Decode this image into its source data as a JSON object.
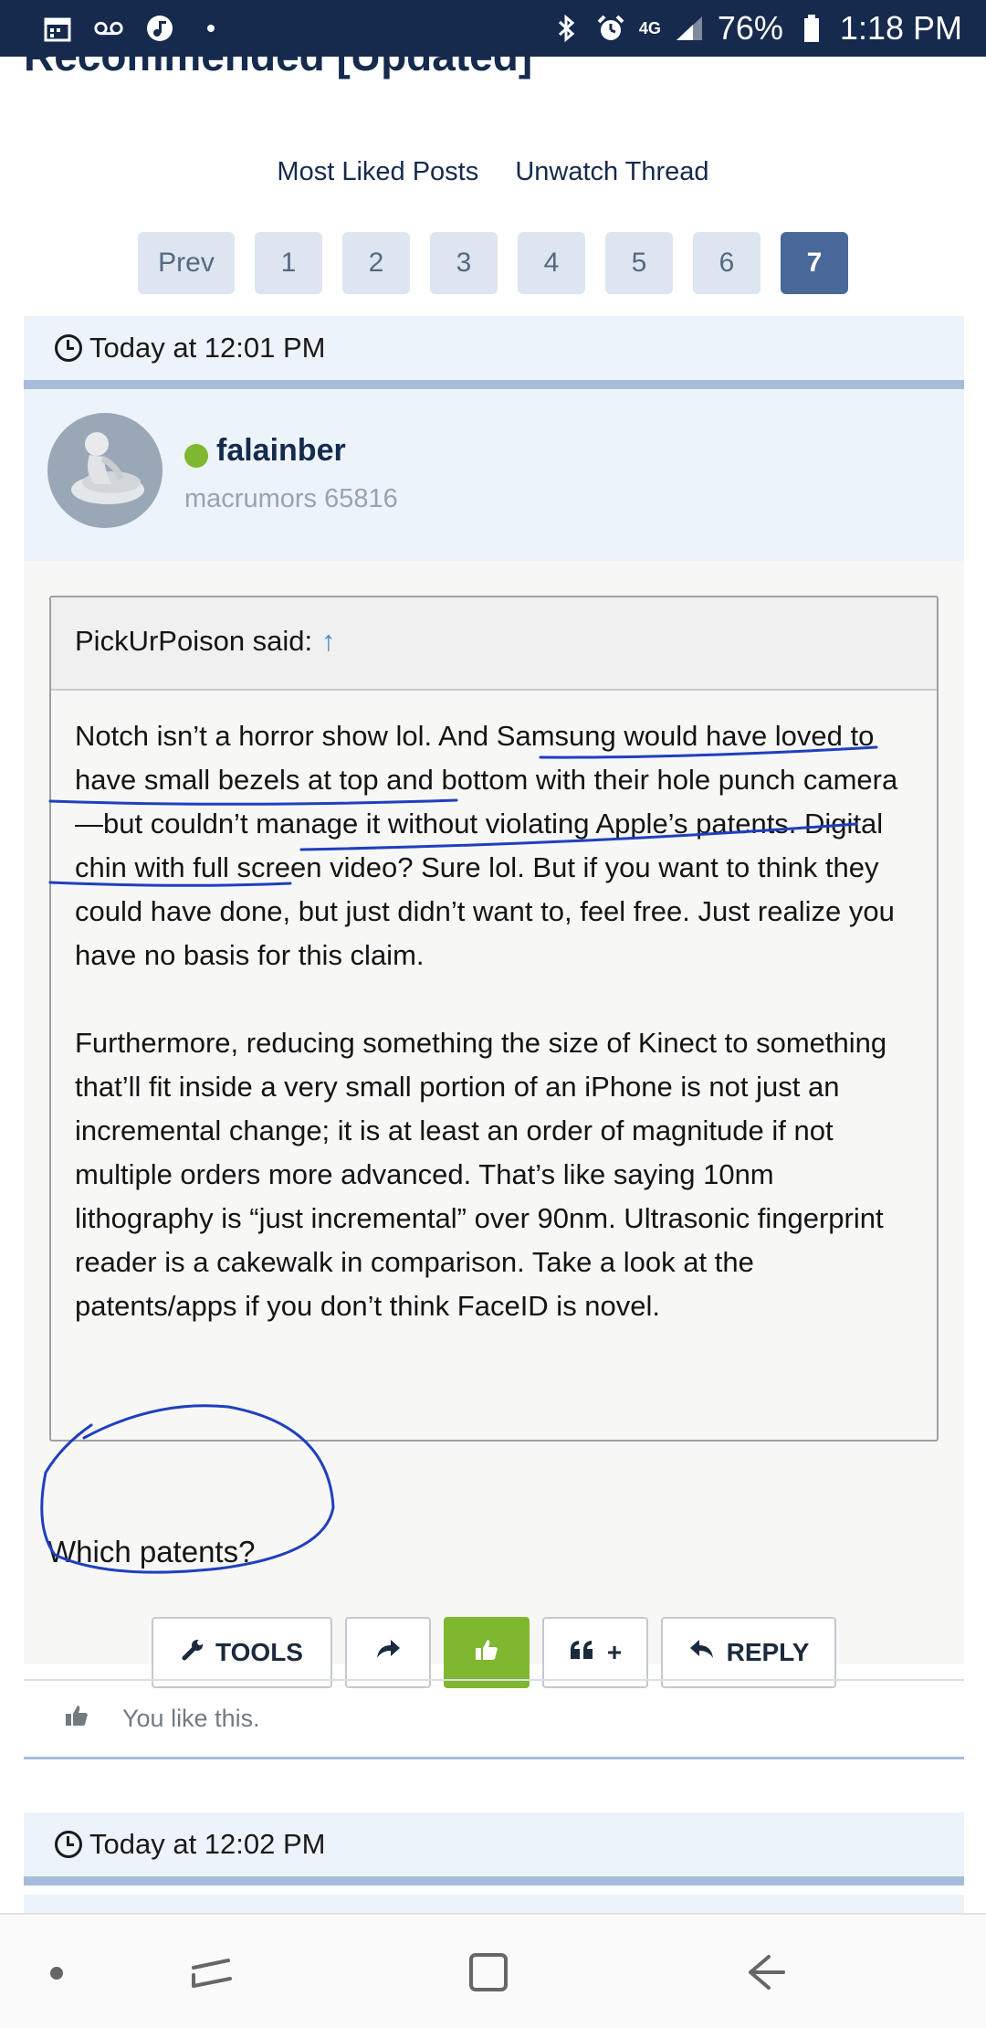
{
  "status_bar": {
    "battery": "76%",
    "time": "1:18 PM",
    "network": "4G",
    "icons": [
      "calendar-icon",
      "voicemail-icon",
      "music-icon",
      "dot-icon",
      "bluetooth-icon",
      "alarm-icon",
      "signal-icon",
      "battery-icon"
    ]
  },
  "thread": {
    "title": "Recommended [Updated]",
    "links": [
      "Most Liked Posts",
      "Unwatch Thread"
    ]
  },
  "pagination": {
    "prev": "Prev",
    "pages": [
      "1",
      "2",
      "3",
      "4",
      "5",
      "6",
      "7"
    ],
    "current": "7"
  },
  "post1": {
    "date": "Today at 12:01 PM",
    "username": "falainber",
    "user_title": "macrumors 65816",
    "quote": {
      "author": "PickUrPoison said:",
      "arrow": "↑",
      "paragraphs": [
        "Notch isn’t a horror show lol. And Samsung would have loved to have small bezels at top and bottom with their hole punch camera—but couldn’t manage it without violating Apple’s patents. Digital chin with full screen video? Sure lol. But if you want to think they could have done, but just didn’t want to, feel free. Just realize you have no basis for this claim.",
        "Furthermore, reducing something the size of Kinect to something that’ll fit inside a very small portion of an iPhone is not just an incremental change; it is at least an order of magnitude if not multiple orders more advanced. That’s like saying 10nm lithography is “just incremental” over 90nm. Ultrasonic fingerprint reader is a cakewalk in comparison. Take a look at the patents/apps if you don’t think FaceID is novel."
      ]
    },
    "reply": "Which patents?",
    "actions": {
      "tools": "TOOLS",
      "multi_quote": "+",
      "reply": "REPLY"
    },
    "liked": "You like this."
  },
  "post2": {
    "date": "Today at 12:02 PM"
  },
  "colors": {
    "status_bar": "#152a4d",
    "link": "#152a4d",
    "page_active": "#48689a",
    "like_green": "#7fb82e",
    "online": "#7fb82e",
    "annotation_ink": "#1f3fbf"
  }
}
